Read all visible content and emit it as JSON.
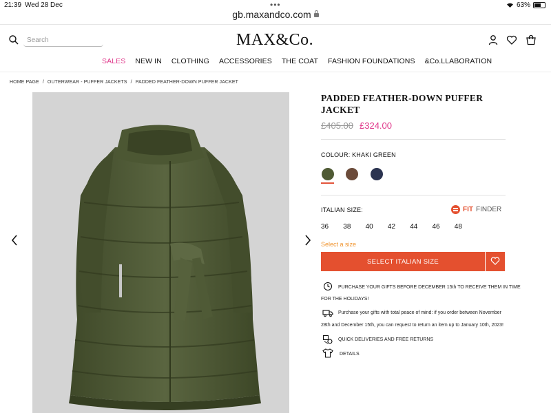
{
  "status": {
    "time": "21:39",
    "date": "Wed 28 Dec",
    "battery": "63%",
    "battery_level": 0.63
  },
  "browser": {
    "url": "gb.maxandco.com"
  },
  "header": {
    "search_placeholder": "Search",
    "logo": "MAX&Co.",
    "icons": [
      "search-icon",
      "account-icon",
      "heart-icon",
      "bag-icon"
    ]
  },
  "nav": {
    "items": [
      "SALES",
      "NEW IN",
      "CLOTHING",
      "ACCESSORIES",
      "THE COAT",
      "FASHION FOUNDATIONS",
      "&Co.LLABORATION"
    ]
  },
  "breadcrumb": [
    "HOME PAGE",
    "/",
    "OUTERWEAR - PUFFER JACKETS",
    "/",
    "PADDED FEATHER-DOWN PUFFER JACKET"
  ],
  "product": {
    "title_line1": "PADDED FEATHER-DOWN PUFFER",
    "title_line2": "JACKET",
    "price_old": "£405.00",
    "price_new": "£324.00",
    "colour_label": "COLOUR: KHAKI GREEN",
    "swatches": [
      {
        "name": "khaki-green",
        "color": "#4f5a34",
        "selected": true
      },
      {
        "name": "brown",
        "color": "#6b4b3a",
        "selected": false
      },
      {
        "name": "navy",
        "color": "#2b3350",
        "selected": false
      }
    ],
    "size_label": "ITALIAN SIZE:",
    "fit_finder_fit": "FIT",
    "fit_finder_finder": "FINDER",
    "sizes": [
      "36",
      "38",
      "40",
      "42",
      "44",
      "46",
      "48"
    ],
    "select_hint": "Select a size",
    "cta": "SELECT ITALIAN SIZE"
  },
  "info": {
    "gift_line1": "PURCHASE YOUR GIFTS BEFORE DECEMBER 15th TO RECEIVE THEM IN TIME",
    "gift_line2": "FOR THE HOLIDAYS!",
    "return_line1": "Purchase your gifts with total peace of mind: if you order between November",
    "return_line2": "28th and December 15th, you can request to return an item up to January 10th, 2023!",
    "delivery": "QUICK DELIVERIES AND FREE RETURNS",
    "details": "DETAILS"
  },
  "colors": {
    "accent": "#e4502f",
    "sale": "#e0378a",
    "hint": "#f0922b",
    "jacket": "#4f5a34"
  }
}
